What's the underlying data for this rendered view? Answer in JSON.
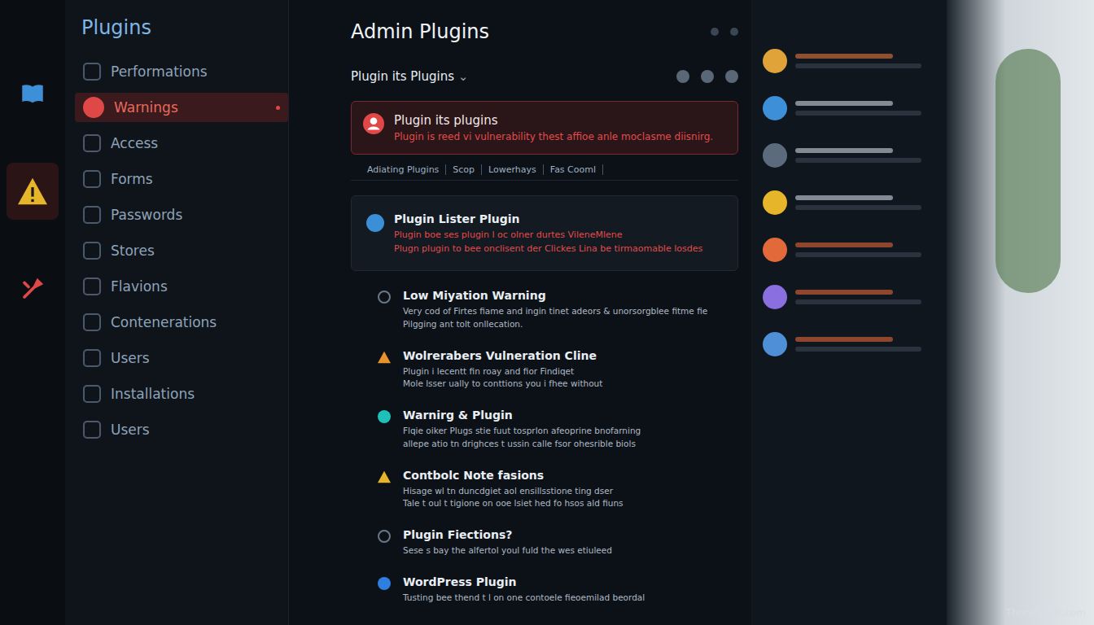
{
  "window": {
    "title": "Admin Plugins"
  },
  "rail": [
    {
      "kind": "book",
      "selected": false
    },
    {
      "kind": "warning",
      "selected": true
    },
    {
      "kind": "tool",
      "selected": false
    }
  ],
  "sidebar": {
    "title": "Plugins",
    "items": [
      {
        "label": "Performations",
        "selected": false
      },
      {
        "label": "Warnings",
        "selected": true
      },
      {
        "label": "Access",
        "selected": false
      },
      {
        "label": "Forms",
        "selected": false
      },
      {
        "label": "Passwords",
        "selected": false
      },
      {
        "label": "Stores",
        "selected": false
      },
      {
        "label": "Flavions",
        "selected": false
      },
      {
        "label": "Contenerations",
        "selected": false
      },
      {
        "label": "Users",
        "selected": false
      },
      {
        "label": "Installations",
        "selected": false
      },
      {
        "label": "Users",
        "selected": false
      }
    ]
  },
  "toolbar": {
    "dropdown": "Plugin its Plugins",
    "caret": "⌄"
  },
  "alert": {
    "title": "Plugin its plugins",
    "message": "Plugin is reed vi vulnerability thest affioe anle moclasme diisnirg."
  },
  "filters": [
    "Adiating Plugins",
    "Scop",
    "Lowerhays",
    "Fas Cooml"
  ],
  "timeline": [
    {
      "kind": "avatar",
      "color": "#3b8fd6",
      "alert": true,
      "title": "Plugin Lister Plugin",
      "lines": [
        "Plugin boe ses plugin l oc olner durtes VileneMlene",
        "Plugn plugin to bee onclisent der Clickes Lina be tirmaomable losdes"
      ]
    },
    {
      "kind": "ring",
      "color": "#6b7785",
      "alert": false,
      "title": "Low Miyation Warning",
      "lines": [
        "Very cod of Firtes fiame and ingin tinet adeors & unorsorgblee fitme fie",
        "Pilgging ant tolt onllecation."
      ]
    },
    {
      "kind": "warning",
      "color": "#e8912d",
      "alert": false,
      "title": "Wolrerabers Vulneration Cline",
      "lines": [
        "Plugin i lecentt fin roay and fior Findiqet",
        "Mole lsser ually to conttions you i fhee without"
      ]
    },
    {
      "kind": "dot",
      "color": "#1fc0b8",
      "alert": false,
      "title": "Warnirg & Plugin",
      "lines": [
        "Flqie oiker Plugs stie fuut tosprlon afeoprine bnofarning",
        "allepe atio tn drighces t ussin calle fsor ohesrible biols"
      ]
    },
    {
      "kind": "warning",
      "color": "#e6b52a",
      "alert": false,
      "title": "Contbolc Note fasions",
      "lines": [
        "Hisage wl tn duncdgiet aol ensillsstione ting dser",
        "Tale t oul t tigione on ooe lsiet hed fo hsos ald fiuns"
      ]
    },
    {
      "kind": "ring",
      "color": "#6b7785",
      "alert": false,
      "title": "Plugin Fiections?",
      "lines": [
        "Sese s bay the alfertol youl fuld the wes etiuleed"
      ]
    },
    {
      "kind": "dot",
      "color": "#2f7fe0",
      "alert": false,
      "title": "WordPress Plugin",
      "lines": [
        "Tusting bee thend t l on one contoele fieoemilad beordal"
      ]
    }
  ],
  "activity": [
    {
      "color": "#e0a33a",
      "accent": "#e27a3d"
    },
    {
      "color": "#3d8fd8",
      "accent": "#cfd8e3"
    },
    {
      "color": "#5b6b7d",
      "accent": "#cfd8e3"
    },
    {
      "color": "#e6b52a",
      "accent": "#cfd8e3"
    },
    {
      "color": "#e2693a",
      "accent": "#e2693a"
    },
    {
      "color": "#8a6fe0",
      "accent": "#e2693a"
    },
    {
      "color": "#4f8fd8",
      "accent": "#e2693a"
    }
  ],
  "watermark": "ThreatVectr.com"
}
